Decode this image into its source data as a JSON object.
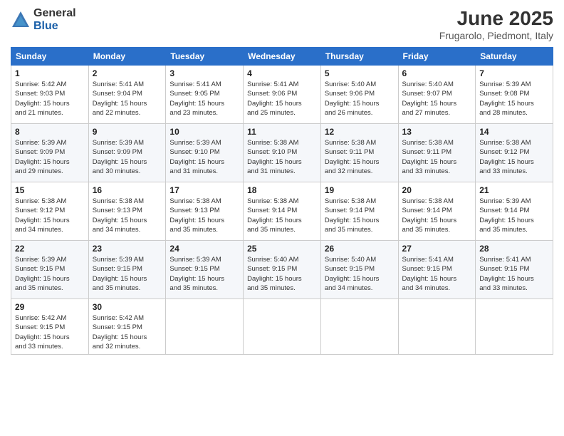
{
  "logo": {
    "general": "General",
    "blue": "Blue"
  },
  "title": "June 2025",
  "location": "Frugarolo, Piedmont, Italy",
  "weekdays": [
    "Sunday",
    "Monday",
    "Tuesday",
    "Wednesday",
    "Thursday",
    "Friday",
    "Saturday"
  ],
  "weeks": [
    [
      {
        "day": "1",
        "info": "Sunrise: 5:42 AM\nSunset: 9:03 PM\nDaylight: 15 hours\nand 21 minutes."
      },
      {
        "day": "2",
        "info": "Sunrise: 5:41 AM\nSunset: 9:04 PM\nDaylight: 15 hours\nand 22 minutes."
      },
      {
        "day": "3",
        "info": "Sunrise: 5:41 AM\nSunset: 9:05 PM\nDaylight: 15 hours\nand 23 minutes."
      },
      {
        "day": "4",
        "info": "Sunrise: 5:41 AM\nSunset: 9:06 PM\nDaylight: 15 hours\nand 25 minutes."
      },
      {
        "day": "5",
        "info": "Sunrise: 5:40 AM\nSunset: 9:06 PM\nDaylight: 15 hours\nand 26 minutes."
      },
      {
        "day": "6",
        "info": "Sunrise: 5:40 AM\nSunset: 9:07 PM\nDaylight: 15 hours\nand 27 minutes."
      },
      {
        "day": "7",
        "info": "Sunrise: 5:39 AM\nSunset: 9:08 PM\nDaylight: 15 hours\nand 28 minutes."
      }
    ],
    [
      {
        "day": "8",
        "info": "Sunrise: 5:39 AM\nSunset: 9:09 PM\nDaylight: 15 hours\nand 29 minutes."
      },
      {
        "day": "9",
        "info": "Sunrise: 5:39 AM\nSunset: 9:09 PM\nDaylight: 15 hours\nand 30 minutes."
      },
      {
        "day": "10",
        "info": "Sunrise: 5:39 AM\nSunset: 9:10 PM\nDaylight: 15 hours\nand 31 minutes."
      },
      {
        "day": "11",
        "info": "Sunrise: 5:38 AM\nSunset: 9:10 PM\nDaylight: 15 hours\nand 31 minutes."
      },
      {
        "day": "12",
        "info": "Sunrise: 5:38 AM\nSunset: 9:11 PM\nDaylight: 15 hours\nand 32 minutes."
      },
      {
        "day": "13",
        "info": "Sunrise: 5:38 AM\nSunset: 9:11 PM\nDaylight: 15 hours\nand 33 minutes."
      },
      {
        "day": "14",
        "info": "Sunrise: 5:38 AM\nSunset: 9:12 PM\nDaylight: 15 hours\nand 33 minutes."
      }
    ],
    [
      {
        "day": "15",
        "info": "Sunrise: 5:38 AM\nSunset: 9:12 PM\nDaylight: 15 hours\nand 34 minutes."
      },
      {
        "day": "16",
        "info": "Sunrise: 5:38 AM\nSunset: 9:13 PM\nDaylight: 15 hours\nand 34 minutes."
      },
      {
        "day": "17",
        "info": "Sunrise: 5:38 AM\nSunset: 9:13 PM\nDaylight: 15 hours\nand 35 minutes."
      },
      {
        "day": "18",
        "info": "Sunrise: 5:38 AM\nSunset: 9:14 PM\nDaylight: 15 hours\nand 35 minutes."
      },
      {
        "day": "19",
        "info": "Sunrise: 5:38 AM\nSunset: 9:14 PM\nDaylight: 15 hours\nand 35 minutes."
      },
      {
        "day": "20",
        "info": "Sunrise: 5:38 AM\nSunset: 9:14 PM\nDaylight: 15 hours\nand 35 minutes."
      },
      {
        "day": "21",
        "info": "Sunrise: 5:39 AM\nSunset: 9:14 PM\nDaylight: 15 hours\nand 35 minutes."
      }
    ],
    [
      {
        "day": "22",
        "info": "Sunrise: 5:39 AM\nSunset: 9:15 PM\nDaylight: 15 hours\nand 35 minutes."
      },
      {
        "day": "23",
        "info": "Sunrise: 5:39 AM\nSunset: 9:15 PM\nDaylight: 15 hours\nand 35 minutes."
      },
      {
        "day": "24",
        "info": "Sunrise: 5:39 AM\nSunset: 9:15 PM\nDaylight: 15 hours\nand 35 minutes."
      },
      {
        "day": "25",
        "info": "Sunrise: 5:40 AM\nSunset: 9:15 PM\nDaylight: 15 hours\nand 35 minutes."
      },
      {
        "day": "26",
        "info": "Sunrise: 5:40 AM\nSunset: 9:15 PM\nDaylight: 15 hours\nand 34 minutes."
      },
      {
        "day": "27",
        "info": "Sunrise: 5:41 AM\nSunset: 9:15 PM\nDaylight: 15 hours\nand 34 minutes."
      },
      {
        "day": "28",
        "info": "Sunrise: 5:41 AM\nSunset: 9:15 PM\nDaylight: 15 hours\nand 33 minutes."
      }
    ],
    [
      {
        "day": "29",
        "info": "Sunrise: 5:42 AM\nSunset: 9:15 PM\nDaylight: 15 hours\nand 33 minutes."
      },
      {
        "day": "30",
        "info": "Sunrise: 5:42 AM\nSunset: 9:15 PM\nDaylight: 15 hours\nand 32 minutes."
      },
      {
        "day": "",
        "info": ""
      },
      {
        "day": "",
        "info": ""
      },
      {
        "day": "",
        "info": ""
      },
      {
        "day": "",
        "info": ""
      },
      {
        "day": "",
        "info": ""
      }
    ]
  ]
}
